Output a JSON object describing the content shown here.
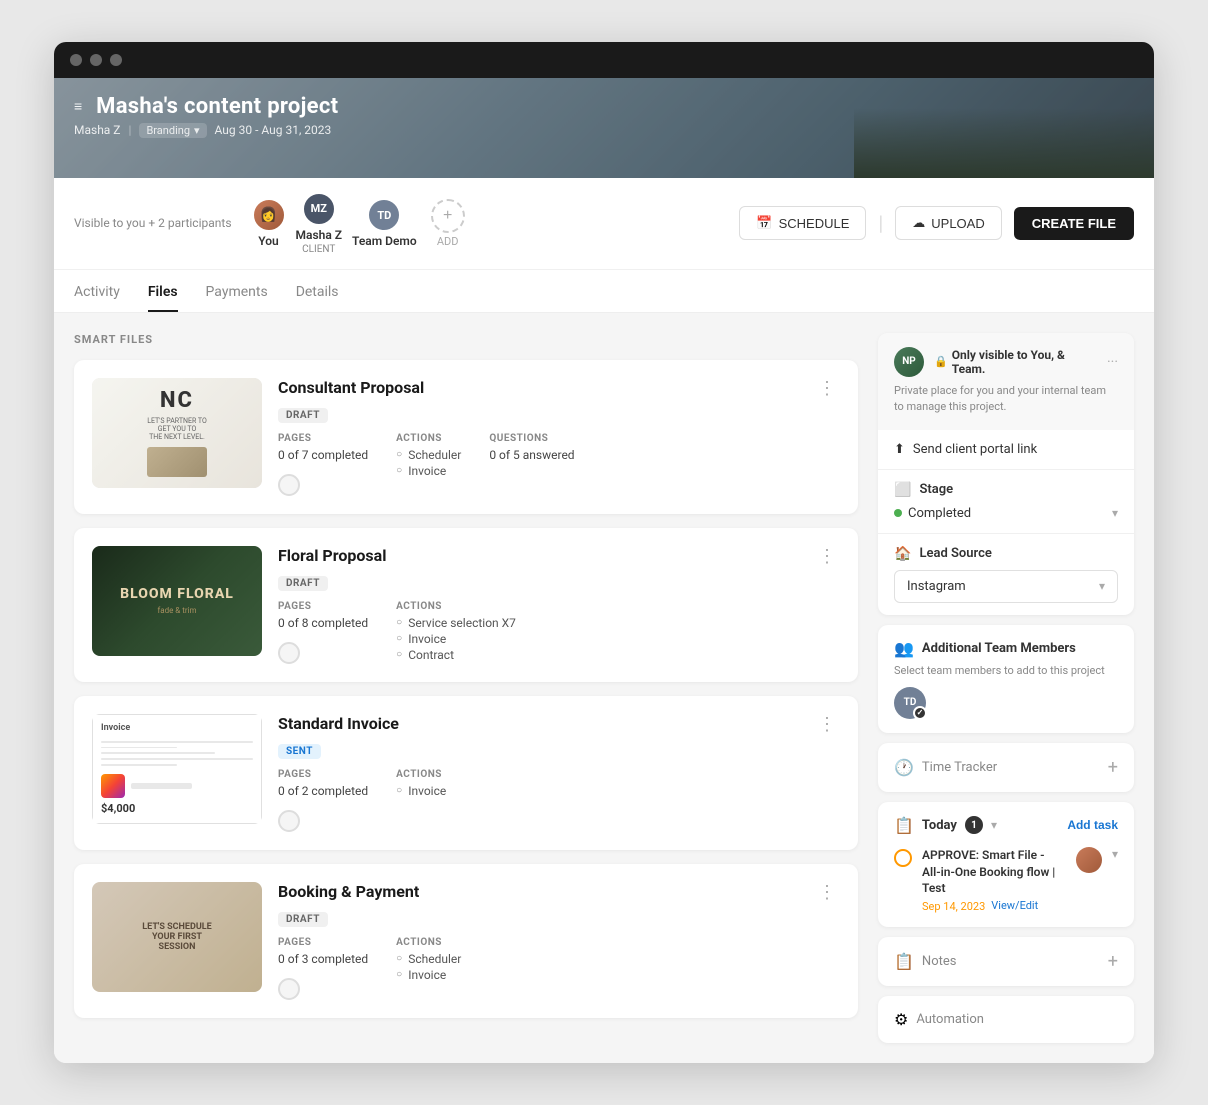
{
  "window": {
    "title": "Masha's content project"
  },
  "titlebar": {
    "dots": [
      "dot1",
      "dot2",
      "dot3"
    ]
  },
  "hero": {
    "menu_icon": "≡",
    "title": "Masha's content project",
    "user": "Masha Z",
    "separator": "|",
    "tag": "Branding",
    "tag_icon": "▾",
    "date_range": "Aug 30 - Aug 31, 2023"
  },
  "participants": {
    "visible_text": "Visible to you + 2 participants",
    "you_label": "You",
    "masha_name": "Masha Z",
    "masha_initials": "MZ",
    "masha_role": "CLIENT",
    "team_name": "Team Demo",
    "team_initials": "TD",
    "add_label": "ADD"
  },
  "actions": {
    "schedule_label": "SCHEDULE",
    "upload_label": "UPLOAD",
    "create_file_label": "CREATE FILE"
  },
  "tabs": [
    {
      "id": "activity",
      "label": "Activity"
    },
    {
      "id": "files",
      "label": "Files",
      "active": true
    },
    {
      "id": "payments",
      "label": "Payments"
    },
    {
      "id": "details",
      "label": "Details"
    }
  ],
  "smart_files_label": "SMART FILES",
  "file_cards": [
    {
      "id": "consultant-proposal",
      "title": "Consultant Proposal",
      "badge": "DRAFT",
      "badge_type": "draft",
      "pages_label": "PAGES",
      "pages_value": "0 of 7 completed",
      "actions_label": "ACTIONS",
      "actions_items": [
        "Scheduler",
        "Invoice"
      ],
      "questions_label": "QUESTIONS",
      "questions_value": "0 of 5 answered"
    },
    {
      "id": "floral-proposal",
      "title": "Floral Proposal",
      "badge": "DRAFT",
      "badge_type": "draft",
      "pages_label": "PAGES",
      "pages_value": "0 of 8 completed",
      "actions_label": "ACTIONS",
      "actions_items": [
        "Service selection X7",
        "Invoice",
        "Contract"
      ]
    },
    {
      "id": "standard-invoice",
      "title": "Standard Invoice",
      "badge": "SENT",
      "badge_type": "sent",
      "pages_label": "PAGES",
      "pages_value": "0 of 2 completed",
      "actions_label": "ACTIONS",
      "actions_items": [
        "Invoice"
      ],
      "invoice_title": "Invoice",
      "invoice_amount": "$4,000"
    },
    {
      "id": "booking-payment",
      "title": "Booking & Payment",
      "badge": "DRAFT",
      "badge_type": "draft",
      "pages_label": "PAGES",
      "pages_value": "0 of 3 completed",
      "actions_label": "ACTIONS",
      "actions_items": [
        "Scheduler",
        "Invoice"
      ]
    }
  ],
  "right_panel": {
    "team_note": {
      "avatar_initials": "NP",
      "title": "Only visible to You, & Team.",
      "desc": "Private place for you and your internal team to manage this project."
    },
    "send_portal": {
      "icon": "↑",
      "label": "Send client portal link"
    },
    "stage": {
      "icon": "⬜",
      "label": "Stage",
      "value": "Completed",
      "dot_color": "#4caf50"
    },
    "lead_source": {
      "icon": "🏠",
      "label": "Lead Source",
      "value": "Instagram"
    },
    "additional_team": {
      "icon": "👥",
      "label": "Additional Team Members",
      "desc": "Select team members to add to this project",
      "member_initials": "TD"
    },
    "time_tracker": {
      "icon": "🕐",
      "label": "Time Tracker"
    },
    "today": {
      "label": "Today",
      "count": "1",
      "add_task_label": "Add task",
      "task": {
        "title": "APPROVE: Smart File - All-in-One Booking flow | Test",
        "date": "Sep 14, 2023",
        "action_label": "View/Edit"
      }
    },
    "notes": {
      "icon": "📋",
      "label": "Notes"
    },
    "automation": {
      "icon": "⚙",
      "label": "Automation"
    }
  }
}
